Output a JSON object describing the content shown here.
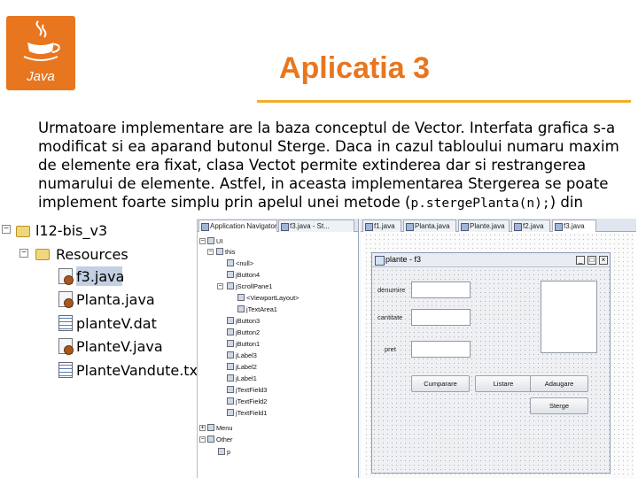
{
  "slide": {
    "title": "Aplicatia 3",
    "logo_text": "Java",
    "paragraph": {
      "line1": "Urmatoare implementare are la baza conceptul de Vector. Interfata grafica s-a",
      "line2": "modificat si ea aparand butonul Sterge. Daca in cazul tabloului numaru maxim",
      "line3": "de elemente era fixat, clasa Vectot permite extinderea dar si restrangerea",
      "line4": "numarului de elemente. Astfel, in aceasta implementarea Stergerea se poate",
      "line5_start": "implement foarte simplu prin apelul unei metode (",
      "line5_code": "p.stergePlanta(n);",
      "line5_end": ") din"
    }
  },
  "project": {
    "root": "l12-bis_v3",
    "folder": "Resources",
    "files": [
      "f3.java",
      "Planta.java",
      "planteV.dat",
      "PlanteV.java",
      "PlanteVandute.txt"
    ],
    "selected": "f3.java"
  },
  "ide": {
    "navigator_tabs": [
      "Application Navigator",
      "f3.java - St..."
    ],
    "editor_tabs": [
      "f1.java",
      "Planta.java",
      "Plante.java",
      "f2.java",
      "f3.java"
    ],
    "structure": [
      "UI",
      "this",
      "<null>",
      "jButton4",
      "jScrollPane1",
      "<ViewportLayout>",
      "jTextArea1",
      "jButton3",
      "jButton2",
      "jButton1",
      "jLabel3",
      "jLabel2",
      "jLabel1",
      "jTextField3",
      "jTextField2",
      "jTextField1",
      "Menu",
      "Other",
      "p"
    ],
    "form": {
      "title": "plante - f3",
      "labels": [
        "denumire",
        "cantitate",
        "pret"
      ],
      "buttons": {
        "cumparare": "Cumparare",
        "listare": "Listare",
        "adaugare": "Adaugare",
        "sterge": "Sterge"
      }
    }
  },
  "colors": {
    "accent": "#e8761e",
    "rule": "#f0ad2c"
  }
}
